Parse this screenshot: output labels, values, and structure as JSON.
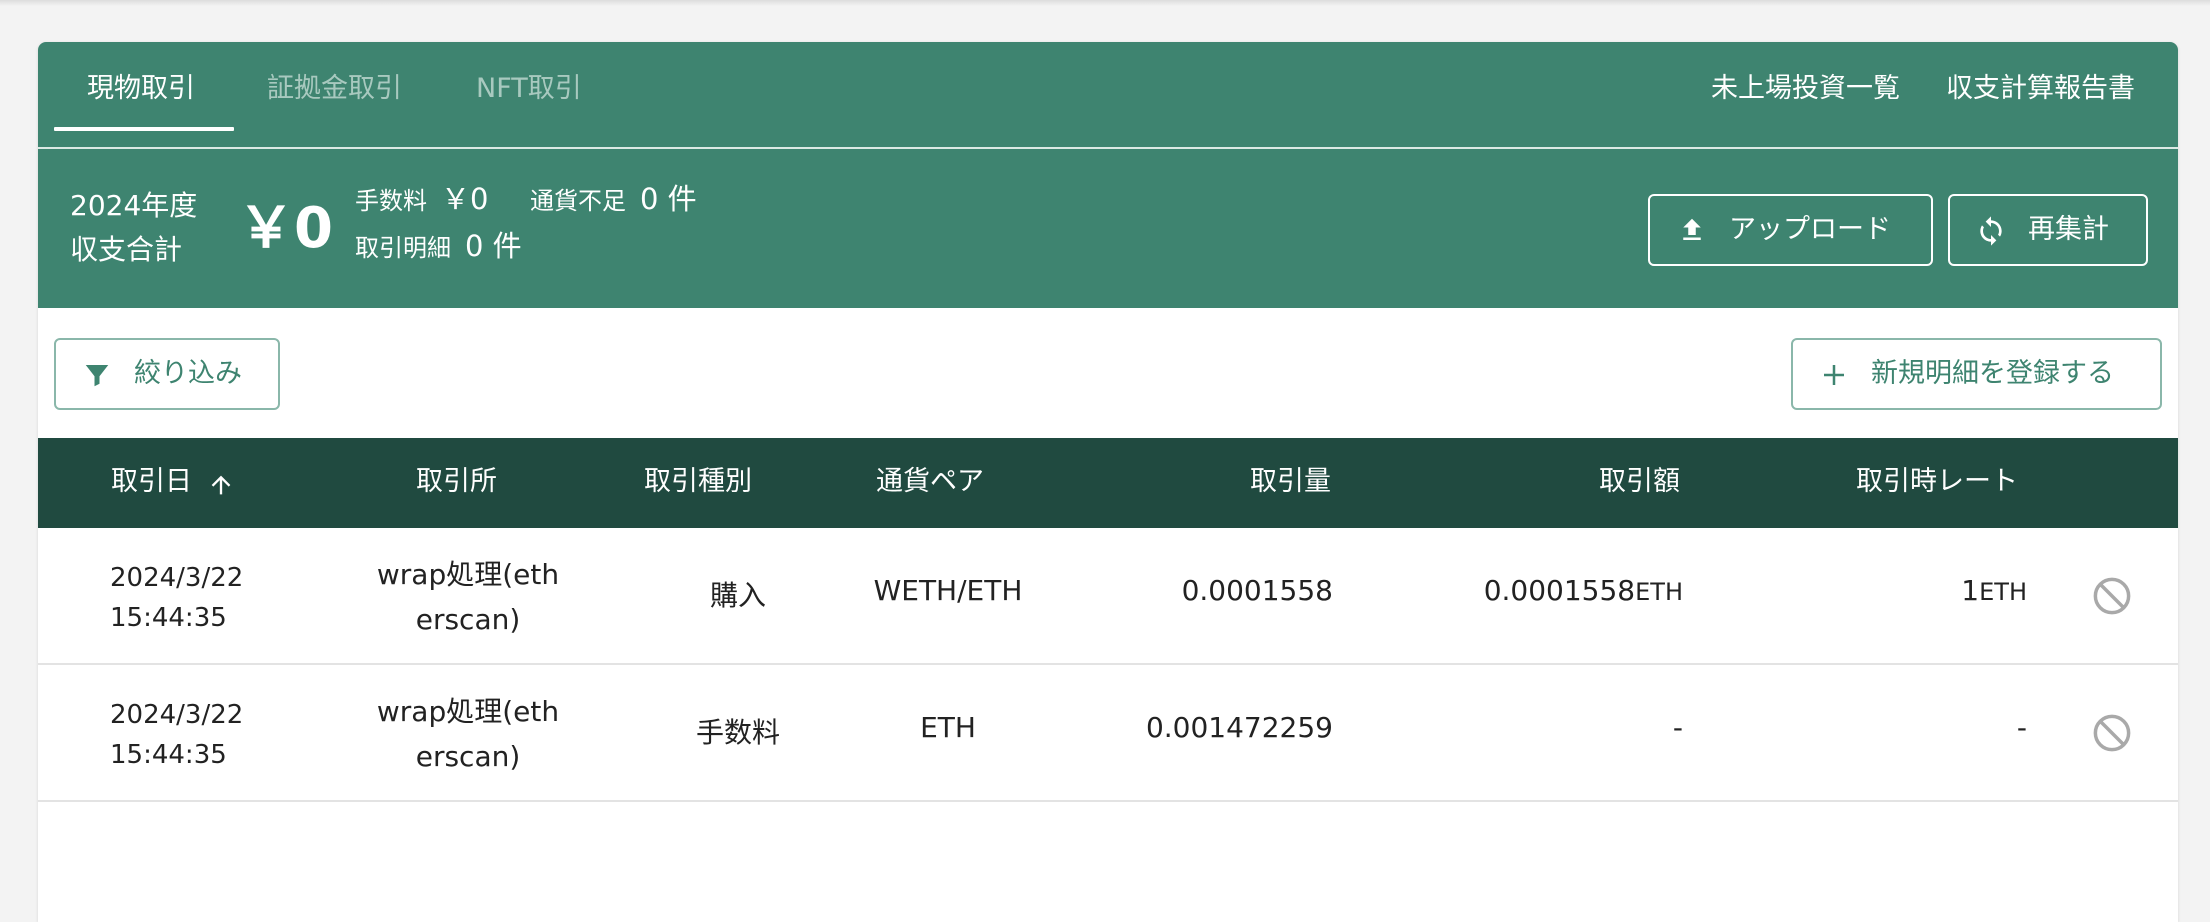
{
  "tabs": [
    {
      "label": "現物取引",
      "active": true
    },
    {
      "label": "証拠金取引",
      "active": false
    },
    {
      "label": "NFT取引",
      "active": false
    }
  ],
  "header_links": {
    "unlisted": "未上場投資一覧",
    "report": "収支計算報告書"
  },
  "summary": {
    "year_label": "2024年度",
    "total_label": "収支合計",
    "total_value": "￥0",
    "fee_label": "手数料",
    "fee_value": "￥0",
    "shortage_label": "通貨不足",
    "shortage_value": "0 件",
    "detail_label": "取引明細",
    "detail_value": "0 件"
  },
  "buttons": {
    "upload": "アップロード",
    "recalc": "再集計",
    "filter": "絞り込み",
    "new_entry": "新規明細を登録する"
  },
  "table": {
    "columns": [
      "取引日",
      "取引所",
      "取引種別",
      "通貨ペア",
      "取引量",
      "取引額",
      "取引時レート"
    ],
    "rows": [
      {
        "date": "2024/3/22",
        "time": "15:44:35",
        "exchange_l1": "wrap処理(eth",
        "exchange_l2": "erscan)",
        "type": "購入",
        "pair": "WETH/ETH",
        "volume": "0.0001558",
        "amount": "0.0001558",
        "amount_unit": "ETH",
        "rate": "1",
        "rate_unit": "ETH"
      },
      {
        "date": "2024/3/22",
        "time": "15:44:35",
        "exchange_l1": "wrap処理(eth",
        "exchange_l2": "erscan)",
        "type": "手数料",
        "pair": "ETH",
        "volume": "0.001472259",
        "amount": "-",
        "amount_unit": "",
        "rate": "-",
        "rate_unit": ""
      }
    ]
  },
  "colors": {
    "header_green": "#3e8470",
    "table_head": "#204a40",
    "accent": "#3e8470"
  },
  "icons": {
    "upload": "upload-icon",
    "recalc": "sync-icon",
    "filter": "filter-icon",
    "add": "plus-icon",
    "sort": "arrow-up-icon",
    "row_action": "ban-icon"
  }
}
